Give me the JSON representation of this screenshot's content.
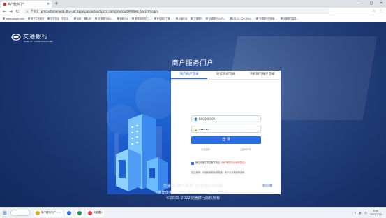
{
  "browser": {
    "tab_title": "商户服务门户",
    "tab_close": "×",
    "new_tab": "+",
    "window_controls": [
      "—",
      "□",
      "✕"
    ],
    "nav_buttons": [
      "←",
      "→",
      "↻"
    ],
    "security_label": "不安全",
    "url": "pmcustomerweb.dhy-uat.appx.pasoxcloud.pccc.com/pmcloud/PMWeb_Uat2/#/login",
    "addr_right_icons": [
      "☆",
      "⋮"
    ],
    "bookmarks": [
      "www.google.com",
      "知乎主页首页",
      "钉钉社区 - 钉钉企...",
      "百度",
      "UAT",
      "交通银行对公...",
      "微软小冰",
      "数据量资历门...",
      "安全岗位工程...",
      "小幽中台",
      "交通银行",
      "交通银行(UAT)...",
      "192.21.222.45/u...",
      "交通银行日报管...",
      "交通银行智能..."
    ]
  },
  "page": {
    "logo_cn": "交通銀行",
    "logo_en": "BANK OF COMMUNICATIONS",
    "portal_title": "商户服务门户",
    "tabs": [
      {
        "label": "商户账户登录",
        "active": true
      },
      {
        "label": "短信快捷登录",
        "active": false
      },
      {
        "label": "手机银行账户登录",
        "active": false
      }
    ],
    "form": {
      "account_icon": "👤",
      "account_value": "B00000000",
      "password_icon": "🔒",
      "password_value": "••••••",
      "login_label": "登 录",
      "link_left": "忘记密码",
      "link_right": "注册商户号"
    },
    "agreement": {
      "prefix": "我已阅读并同意服务协议",
      "red_part": "《商户服务平台使用协议》",
      "suffix": ""
    },
    "note": "建议使用：请使用最新版浏览器，用于未来更新等使用",
    "help_link": "常见问题",
    "footer_lines": [
      "交通银行商户服务门户支持IPv6网络",
      "推荐使用Chrome或IE11.0以上浏览器使用",
      "©2020–2022交通银行版权所有"
    ]
  },
  "taskbar": {
    "start_icon": "⊞",
    "apps": [
      {
        "label": "商户服务门户 - ...",
        "color": "#e0a91f"
      },
      {
        "label": "",
        "color": "#2b6de0"
      },
      {
        "label": "",
        "color": "#1a8f5a"
      },
      {
        "label": "功能图1",
        "color": "#d83b3b"
      }
    ],
    "tray_icons": [
      "∧",
      "🔊",
      "中"
    ],
    "time": "9:04",
    "date": "2023/1/22"
  }
}
